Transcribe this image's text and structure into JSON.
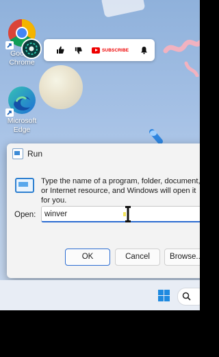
{
  "desktop": {
    "icons": [
      {
        "label": "Google Chrome",
        "label_line1": "Google",
        "label_line2": "Chrome",
        "icon": "chrome-icon"
      },
      {
        "label": "Microsoft Edge",
        "label_line1": "Microsoft",
        "label_line2": "Edge",
        "icon": "edge-icon"
      }
    ]
  },
  "banner": {
    "subscribe_label": "SUBSCRIBE",
    "icons": [
      "like-icon",
      "dislike-icon",
      "youtube-icon",
      "bell-icon"
    ]
  },
  "run_dialog": {
    "title": "Run",
    "description": "Type the name of a program, folder, document, or Internet resource, and Windows will open it for you.",
    "open_label": "Open:",
    "open_value": "winver",
    "ok_label": "OK",
    "cancel_label": "Cancel",
    "browse_label": "Browse..."
  },
  "colors": {
    "accent": "#2a6bd0",
    "youtube_red": "#e00000"
  }
}
